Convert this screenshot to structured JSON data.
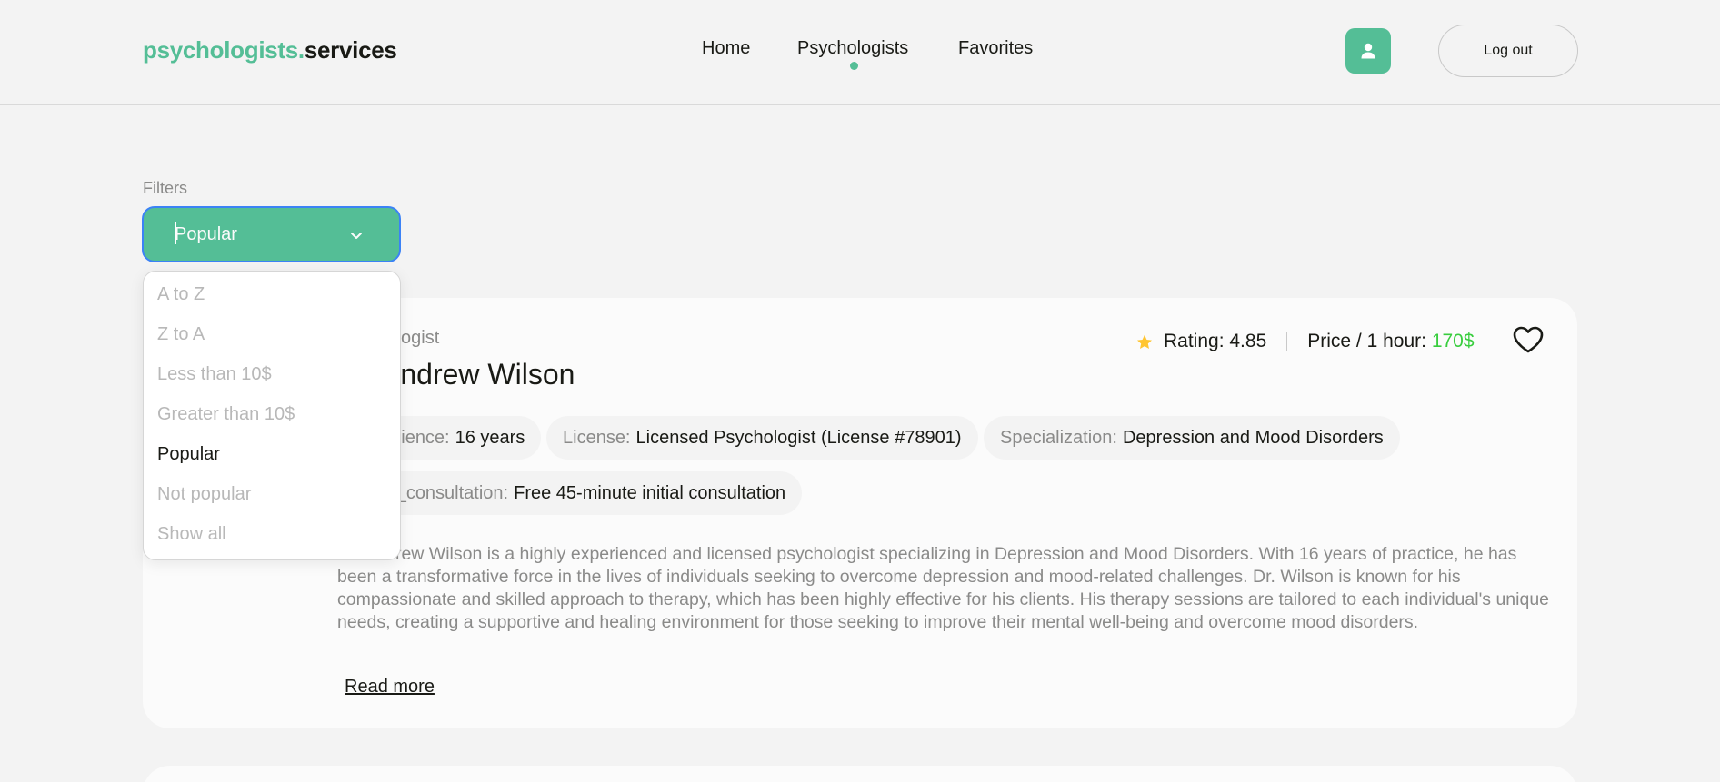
{
  "header": {
    "logo_brand": "psychologists",
    "logo_dot": ".",
    "logo_tld": "services",
    "nav": [
      {
        "label": "Home"
      },
      {
        "label": "Psychologists",
        "active": true
      },
      {
        "label": "Favorites"
      }
    ],
    "user_icon": "user-icon",
    "logout_label": "Log out"
  },
  "filters": {
    "label": "Filters",
    "selected": "Popular",
    "options": [
      {
        "label": "A to Z",
        "active": false
      },
      {
        "label": "Z to A",
        "active": false
      },
      {
        "label": "Less than 10$",
        "active": false
      },
      {
        "label": "Greater than 10$",
        "active": false
      },
      {
        "label": "Popular",
        "active": true
      },
      {
        "label": "Not popular",
        "active": false
      },
      {
        "label": "Show all",
        "active": false
      }
    ]
  },
  "card": {
    "role": "Psychologist",
    "name": "Dr. Andrew Wilson",
    "rating_label": "Rating: 4.85",
    "price_label": "Price / 1 hour: ",
    "price_value": "170$",
    "chips": {
      "experience_key": "Experience:",
      "experience_val": "16 years",
      "license_key": "License:",
      "license_val": "Licensed Psychologist (License #78901)",
      "specialization_key": "Specialization:",
      "specialization_val": "Depression and Mood Disorders",
      "consultation_key": "Initial_consultation:",
      "consultation_val": "Free 45-minute initial consultation"
    },
    "description": "Dr. Andrew Wilson is a highly experienced and licensed psychologist specializing in Depression and Mood Disorders. With 16 years of practice, he has been a transformative force in the lives of individuals seeking to overcome depression and mood-related challenges. Dr. Wilson is known for his compassionate and skilled approach to therapy, which has been highly effective for his clients. His therapy sessions are tailored to each individual's unique needs, creating a supportive and healing environment for those seeking to improve their mental well-being and overcome mood disorders.",
    "read_more": "Read more"
  },
  "colors": {
    "accent": "#54be96",
    "price": "#38cd3e",
    "star": "#ffc531",
    "muted": "#8a8a89"
  }
}
